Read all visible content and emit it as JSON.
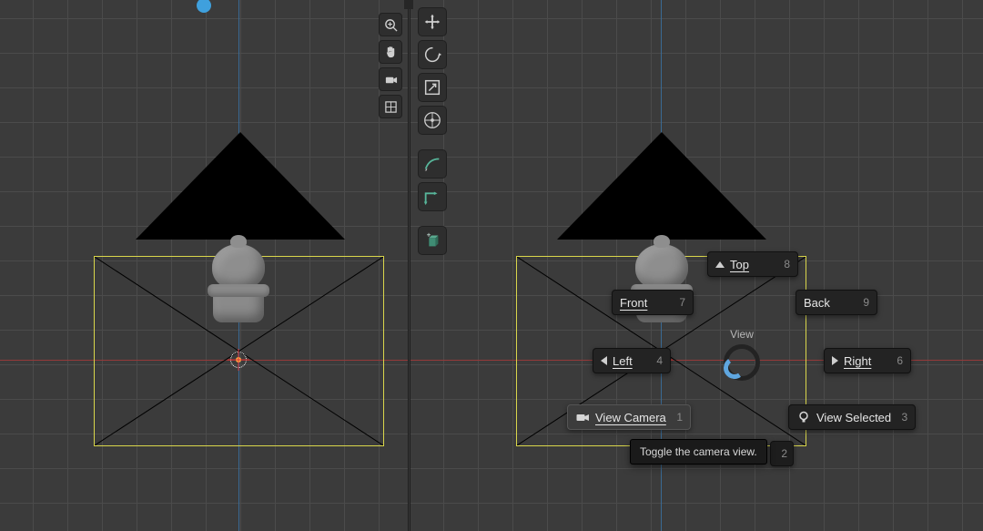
{
  "pie_menu": {
    "title": "View",
    "top": {
      "label": "Top",
      "key": "8"
    },
    "front": {
      "label": "Front",
      "key": "7"
    },
    "back": {
      "label": "Back",
      "key": "9"
    },
    "left": {
      "label": "Left",
      "key": "4"
    },
    "right": {
      "label": "Right",
      "key": "6"
    },
    "view_camera": {
      "label": "View Camera",
      "key": "1"
    },
    "view_selected": {
      "label": "View Selected",
      "key": "3"
    },
    "bottom_key": "2",
    "tooltip": "Toggle the camera view."
  },
  "left_viewport_icons": {
    "zoom": "zoom-icon",
    "pan": "pan-icon",
    "camera": "camera-icon",
    "grid": "grid-icon"
  },
  "tools": {
    "move": "move-icon",
    "rotate": "rotate-icon",
    "scale": "scale-icon",
    "transform": "transform-icon",
    "annotate": "annotate-icon",
    "measure": "measure-icon",
    "addcube": "addcube-icon"
  }
}
